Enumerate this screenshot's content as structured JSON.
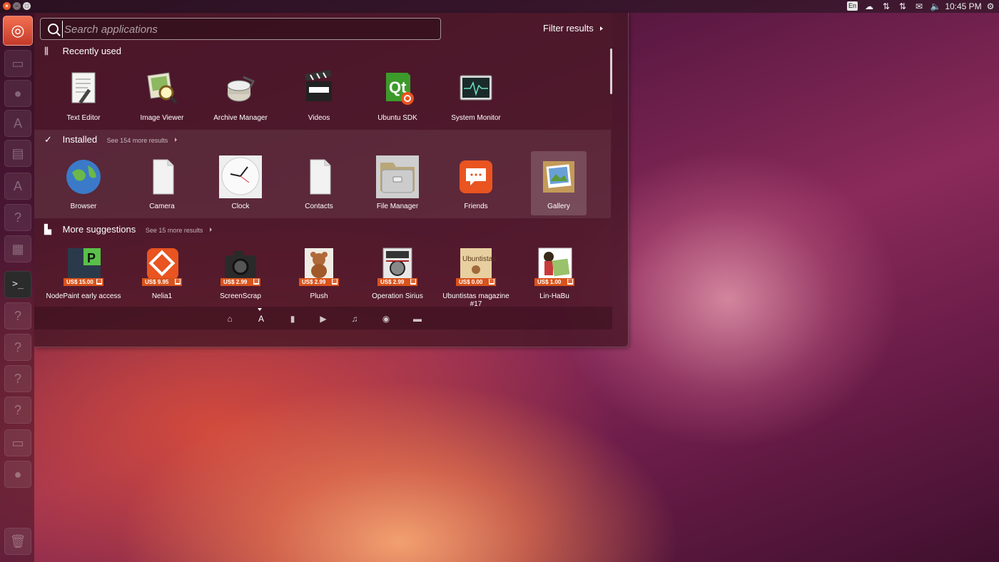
{
  "panel": {
    "lang": "En",
    "clock": "10:45 PM",
    "icons": [
      "cloud-icon",
      "network-up-down-icon",
      "network-transfer-icon",
      "mail-icon",
      "volume-icon",
      "settings-gear-icon"
    ]
  },
  "window_buttons": {
    "close": "×",
    "minimize": "–",
    "maximize": "□"
  },
  "launcher": {
    "items": [
      "ubuntu-home-icon",
      "files-icon",
      "browser-icon",
      "software-center-icon",
      "system-settings-icon",
      "update-icon",
      "unknown-app-icon",
      "workspace-icon",
      "terminal-icon",
      "unknown-app-icon",
      "unknown-app-icon",
      "unknown-app-icon",
      "unknown-app-icon",
      "unknown-app-icon",
      "trash-icon"
    ],
    "terminal_glyph": ">_"
  },
  "search": {
    "placeholder": "Search applications",
    "value": ""
  },
  "filter": {
    "label": "Filter results"
  },
  "categories": [
    {
      "title": "Recently used",
      "more": "",
      "items": [
        {
          "label": "Text Editor",
          "icon": "text-editor-icon"
        },
        {
          "label": "Image Viewer",
          "icon": "image-viewer-icon"
        },
        {
          "label": "Archive Manager",
          "icon": "archive-manager-icon"
        },
        {
          "label": "Videos",
          "icon": "videos-icon"
        },
        {
          "label": "Ubuntu SDK",
          "icon": "ubuntu-sdk-icon"
        },
        {
          "label": "System Monitor",
          "icon": "system-monitor-icon"
        }
      ]
    },
    {
      "title": "Installed",
      "more": "See 154 more results",
      "items": [
        {
          "label": "Browser",
          "icon": "browser-icon"
        },
        {
          "label": "Camera",
          "icon": "camera-icon"
        },
        {
          "label": "Clock",
          "icon": "clock-icon"
        },
        {
          "label": "Contacts",
          "icon": "contacts-icon"
        },
        {
          "label": "File Manager",
          "icon": "file-manager-icon"
        },
        {
          "label": "Friends",
          "icon": "friends-icon"
        },
        {
          "label": "Gallery",
          "icon": "gallery-icon"
        }
      ]
    },
    {
      "title": "More suggestions",
      "more": "See 15 more results",
      "items": [
        {
          "label": "NodePaint early access",
          "price": "US$ 15.00",
          "icon": "nodepaint-icon"
        },
        {
          "label": "Nelia1",
          "price": "US$ 9.95",
          "icon": "nelia1-icon"
        },
        {
          "label": "ScreenScrap",
          "price": "US$ 2.99",
          "icon": "screenscrap-icon"
        },
        {
          "label": "Plush",
          "price": "US$ 2.99",
          "icon": "plush-icon"
        },
        {
          "label": "Operation Sirius",
          "price": "US$ 2.99",
          "icon": "operation-sirius-icon"
        },
        {
          "label": "Ubuntistas magazine #17",
          "price": "US$ 0.00",
          "icon": "ubuntistas-icon",
          "icon_text": "Ubuntistas"
        },
        {
          "label": "Lin-HaBu",
          "price": "US$ 1.00",
          "icon": "lin-habu-icon"
        }
      ]
    }
  ],
  "sdk_text": "Qt",
  "lenses": [
    "home-lens-icon",
    "applications-lens-icon",
    "files-lens-icon",
    "video-lens-icon",
    "music-lens-icon",
    "photos-lens-icon",
    "social-lens-icon"
  ],
  "colors": {
    "accent": "#e95420",
    "price_tag": "#d9531c"
  }
}
